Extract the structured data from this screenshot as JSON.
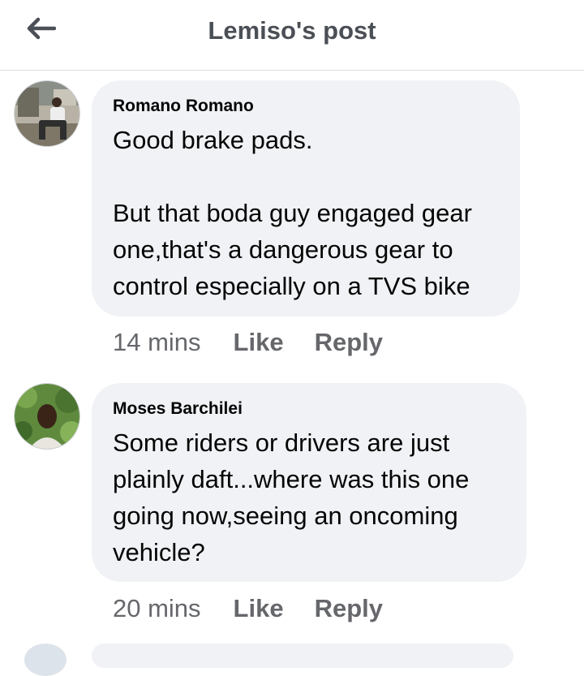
{
  "header": {
    "title": "Lemiso's post",
    "back_icon": "arrow-left-icon"
  },
  "comments": [
    {
      "author": "Romano Romano",
      "text": "Good brake pads.\n\nBut that boda guy engaged gear one,that's a dangerous gear to control especially on a TVS bike",
      "time": "14 mins",
      "like_label": "Like",
      "reply_label": "Reply"
    },
    {
      "author": "Moses Barchilei",
      "text": "Some riders or drivers are just plainly daft...where was this one going now,seeing an oncoming vehicle?",
      "time": "20 mins",
      "like_label": "Like",
      "reply_label": "Reply"
    }
  ],
  "colors": {
    "bubble": "#f0f2f5",
    "meta_text": "#65676b",
    "header_title": "#4b4f56"
  }
}
